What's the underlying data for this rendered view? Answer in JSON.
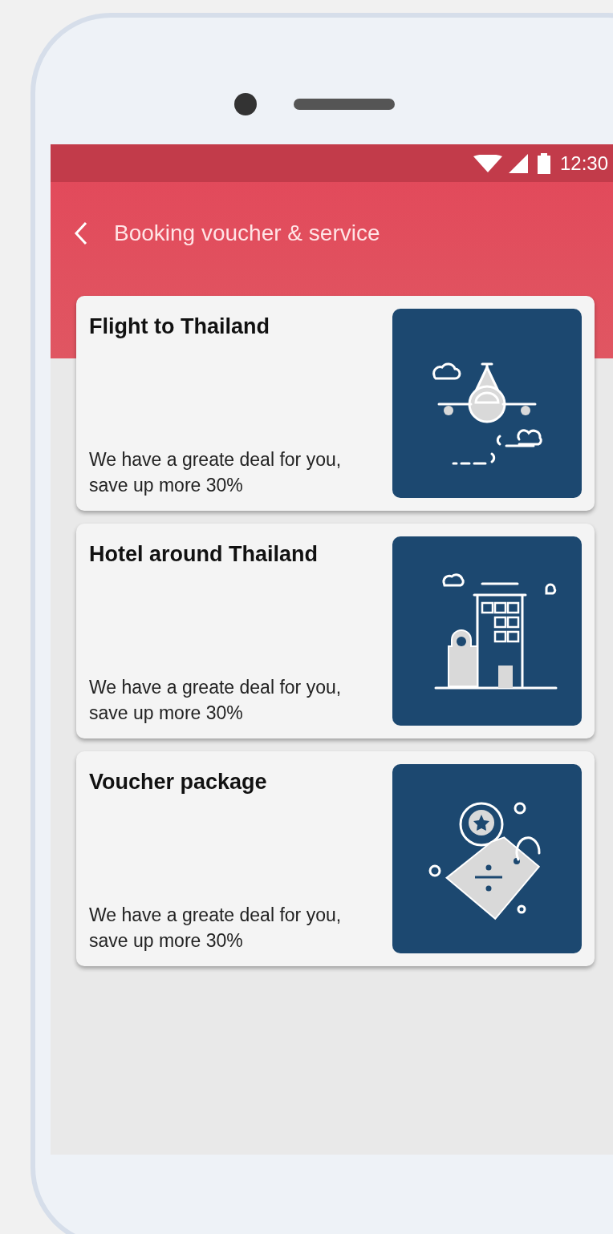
{
  "status_bar": {
    "time": "12:30"
  },
  "app_bar": {
    "title": "Booking voucher & service"
  },
  "cards": [
    {
      "kind": "plane",
      "title": "Flight to Thailand",
      "description": "We have a greate deal for you, save up more 30%"
    },
    {
      "kind": "hotel",
      "title": "Hotel around Thailand",
      "description": "We have a greate deal for you, save up more 30%"
    },
    {
      "kind": "voucher",
      "title": "Voucher package",
      "description": "We have a greate deal for you, save up more 30%"
    }
  ]
}
